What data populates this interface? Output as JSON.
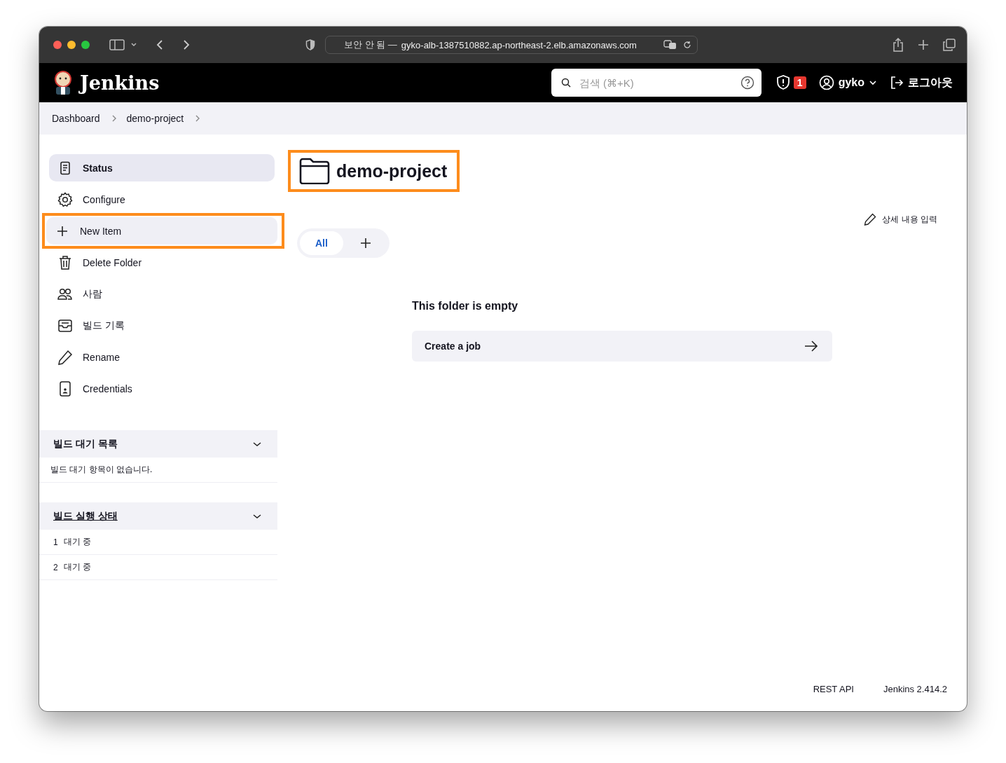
{
  "browser": {
    "url_prefix": "보안 안 됨 —",
    "url": "gyko-alb-1387510882.ap-northeast-2.elb.amazonaws.com"
  },
  "header": {
    "logo_text": "Jenkins",
    "search": {
      "placeholder": "검색 (⌘+K)"
    },
    "security_badge": "1",
    "user": "gyko",
    "logout": "로그아웃"
  },
  "breadcrumbs": [
    "Dashboard",
    "demo-project"
  ],
  "sidebar": {
    "items": [
      {
        "label": "Status",
        "selected": true,
        "hovered": false,
        "highlighted": false
      },
      {
        "label": "Configure",
        "selected": false,
        "hovered": false,
        "highlighted": false
      },
      {
        "label": "New Item",
        "selected": false,
        "hovered": true,
        "highlighted": true
      },
      {
        "label": "Delete Folder",
        "selected": false,
        "hovered": false,
        "highlighted": false
      },
      {
        "label": "사람",
        "selected": false,
        "hovered": false,
        "highlighted": false
      },
      {
        "label": "빌드 기록",
        "selected": false,
        "hovered": false,
        "highlighted": false
      },
      {
        "label": "Rename",
        "selected": false,
        "hovered": false,
        "highlighted": false
      },
      {
        "label": "Credentials",
        "selected": false,
        "hovered": false,
        "highlighted": false
      }
    ],
    "build_queue": {
      "title": "빌드 대기 목록",
      "expanded": true,
      "empty_text": "빌드 대기 항목이 없습니다."
    },
    "executors": {
      "title": "빌드 실행 상태",
      "expanded": true,
      "rows": [
        {
          "number": "1",
          "status": "대기 중"
        },
        {
          "number": "2",
          "status": "대기 중"
        }
      ]
    }
  },
  "main": {
    "title": "demo-project",
    "title_highlighted": true,
    "edit_description": "상세 내용 입력",
    "view_tabs": [
      {
        "label": "All",
        "selected": true
      }
    ],
    "empty_title": "This folder is empty",
    "create_job": "Create a job"
  },
  "footer": [
    "REST API",
    "Jenkins 2.414.2"
  ]
}
